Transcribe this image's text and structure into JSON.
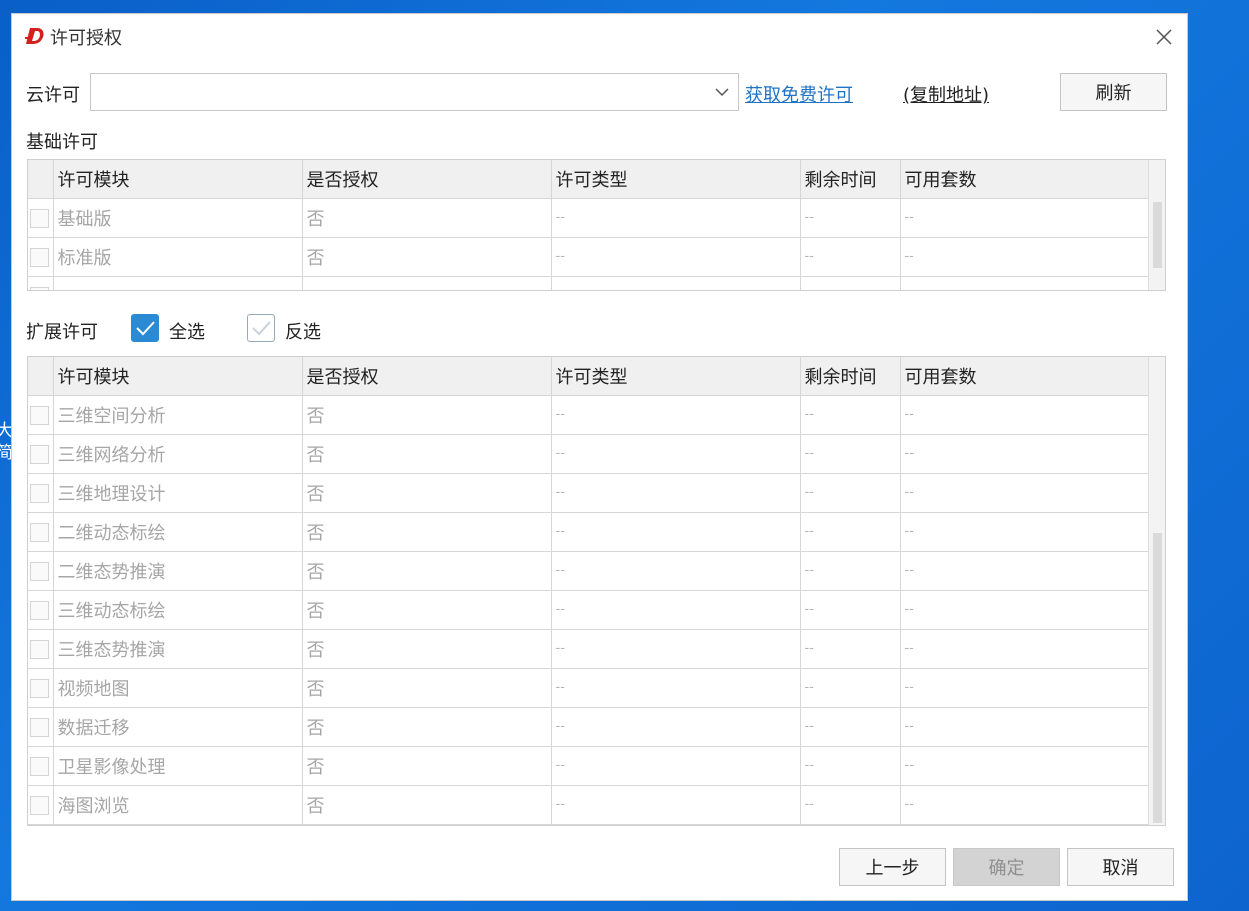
{
  "desktop": {
    "text_line1": "大",
    "text_line2": "简"
  },
  "dialog": {
    "title": "许可授权",
    "cloud_label": "云许可",
    "cloud_combo_value": "",
    "get_free_link": "获取免费许可",
    "copy_address_link": "(复制地址)",
    "refresh_label": "刷新",
    "basic_section_label": "基础许可",
    "ext_section_label": "扩展许可",
    "select_all_label": "全选",
    "invert_label": "反选",
    "columns": [
      "许可模块",
      "是否授权",
      "许可类型",
      "剩余时间",
      "可用套数"
    ],
    "basic_rows": [
      {
        "module": "基础版",
        "auth": "否",
        "type": "--",
        "remaining": "--",
        "count": "--"
      },
      {
        "module": "标准版",
        "auth": "否",
        "type": "--",
        "remaining": "--",
        "count": "--"
      }
    ],
    "ext_rows": [
      {
        "module": "三维空间分析",
        "auth": "否",
        "type": "--",
        "remaining": "--",
        "count": "--"
      },
      {
        "module": "三维网络分析",
        "auth": "否",
        "type": "--",
        "remaining": "--",
        "count": "--"
      },
      {
        "module": "三维地理设计",
        "auth": "否",
        "type": "--",
        "remaining": "--",
        "count": "--"
      },
      {
        "module": "二维动态标绘",
        "auth": "否",
        "type": "--",
        "remaining": "--",
        "count": "--"
      },
      {
        "module": "二维态势推演",
        "auth": "否",
        "type": "--",
        "remaining": "--",
        "count": "--"
      },
      {
        "module": "三维动态标绘",
        "auth": "否",
        "type": "--",
        "remaining": "--",
        "count": "--"
      },
      {
        "module": "三维态势推演",
        "auth": "否",
        "type": "--",
        "remaining": "--",
        "count": "--"
      },
      {
        "module": "视频地图",
        "auth": "否",
        "type": "--",
        "remaining": "--",
        "count": "--"
      },
      {
        "module": "数据迁移",
        "auth": "否",
        "type": "--",
        "remaining": "--",
        "count": "--"
      },
      {
        "module": "卫星影像处理",
        "auth": "否",
        "type": "--",
        "remaining": "--",
        "count": "--"
      },
      {
        "module": "海图浏览",
        "auth": "否",
        "type": "--",
        "remaining": "--",
        "count": "--"
      }
    ],
    "prev_label": "上一步",
    "ok_label": "确定",
    "cancel_label": "取消"
  },
  "colors": {
    "accent": "#2a8ad4",
    "link": "#1f73c6",
    "logo": "#d4201f"
  },
  "icons": {
    "logo": "d-logo-icon",
    "close": "close-icon",
    "dropdown": "chevron-down-icon",
    "check": "check-icon"
  }
}
